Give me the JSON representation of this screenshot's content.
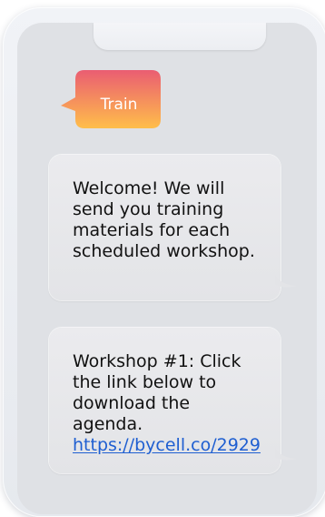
{
  "tag": {
    "label": "Train"
  },
  "messages": [
    {
      "text": "Welcome! We will send you training materials for each scheduled workshop."
    },
    {
      "text": "Workshop #1: Click the link below to download the agenda.",
      "link": "https://bycell.co/2929"
    }
  ],
  "colors": {
    "pill_top": "#ea5d72",
    "pill_bottom": "#ffbe4a",
    "link": "#1f5fd1"
  }
}
